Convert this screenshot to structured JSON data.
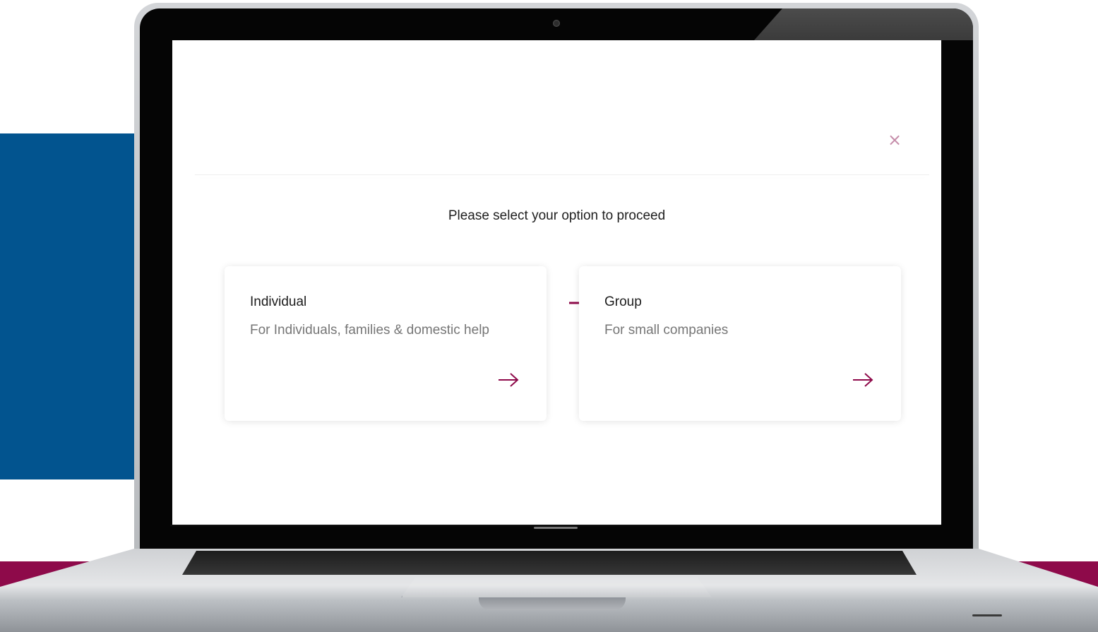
{
  "modal": {
    "close_label": "×",
    "prompt": "Please select your option to proceed",
    "cards": [
      {
        "title": "Individual",
        "description": "For Individuals, families & domestic help",
        "arrow_icon": "arrow-right-icon"
      },
      {
        "title": "Group",
        "description": "For small companies",
        "arrow_icon": "arrow-right-icon"
      }
    ]
  },
  "colors": {
    "accent": "#8e0a4a",
    "blue_block": "#02548f",
    "close": "#c58ca9"
  },
  "annotation": {
    "icon": "pointer-arrow-icon"
  }
}
